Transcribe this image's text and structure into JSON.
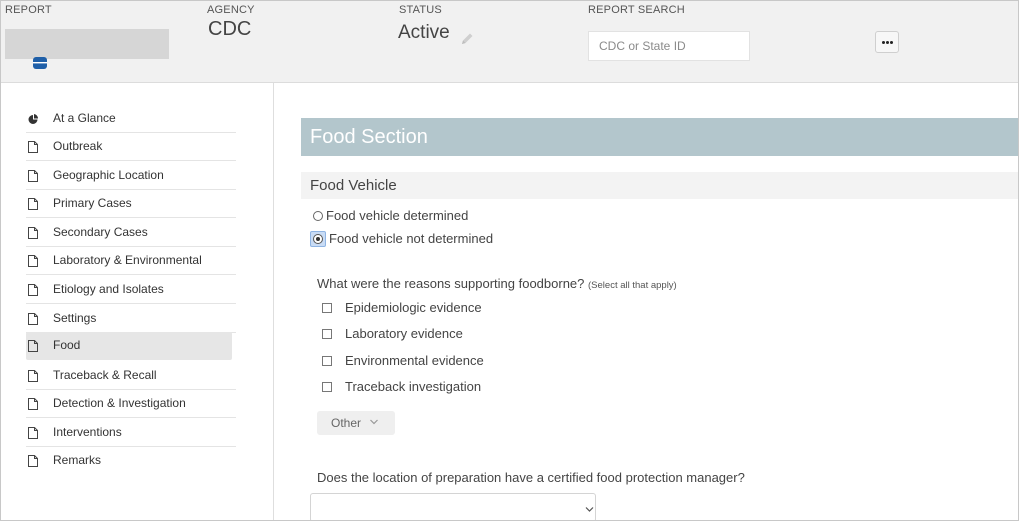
{
  "header": {
    "report_label": "REPORT",
    "agency_label": "AGENCY",
    "agency_value": "CDC",
    "status_label": "STATUS",
    "status_value": "Active",
    "search_label": "REPORT SEARCH",
    "search_placeholder": "CDC or State ID",
    "search_value": "",
    "more_button_icon": "ellipsis-icon",
    "report_icon": "database-icon",
    "edit_icon": "pencil-icon"
  },
  "sidebar": {
    "items": [
      {
        "label": "At a Glance",
        "icon": "pie-chart-icon",
        "active": false
      },
      {
        "label": "Outbreak",
        "icon": "file-icon",
        "active": false
      },
      {
        "label": "Geographic Location",
        "icon": "file-icon",
        "active": false
      },
      {
        "label": "Primary Cases",
        "icon": "file-icon",
        "active": false
      },
      {
        "label": "Secondary Cases",
        "icon": "file-icon",
        "active": false
      },
      {
        "label": "Laboratory & Environmental",
        "icon": "file-icon",
        "active": false
      },
      {
        "label": "Etiology and Isolates",
        "icon": "file-icon",
        "active": false
      },
      {
        "label": "Settings",
        "icon": "file-icon",
        "active": false
      },
      {
        "label": "Food",
        "icon": "file-icon",
        "active": true
      },
      {
        "label": "Traceback & Recall",
        "icon": "file-icon",
        "active": false
      },
      {
        "label": "Detection & Investigation",
        "icon": "file-icon",
        "active": false
      },
      {
        "label": "Interventions",
        "icon": "file-icon",
        "active": false
      },
      {
        "label": "Remarks",
        "icon": "file-icon",
        "active": false
      }
    ]
  },
  "main": {
    "section_title": "Food Section",
    "subsection_title": "Food Vehicle",
    "vehicle_options": [
      {
        "label": "Food vehicle determined",
        "checked": false
      },
      {
        "label": "Food vehicle not determined",
        "checked": true
      }
    ],
    "reasons_question": "What were the reasons supporting foodborne?",
    "reasons_hint": "(Select all that apply)",
    "reasons": [
      {
        "label": "Epidemiologic evidence",
        "checked": false
      },
      {
        "label": "Laboratory evidence",
        "checked": false
      },
      {
        "label": "Environmental evidence",
        "checked": false
      },
      {
        "label": "Traceback investigation",
        "checked": false
      }
    ],
    "other_button": "Other",
    "manager_question": "Does the location of preparation have a certified food protection manager?",
    "manager_select_value": ""
  },
  "colors": {
    "section_bar": "#b3c6cc",
    "header_bg": "#f1f1f1",
    "active_nav": "#e6e6e6",
    "radio_highlight": "#c9dcf5"
  }
}
